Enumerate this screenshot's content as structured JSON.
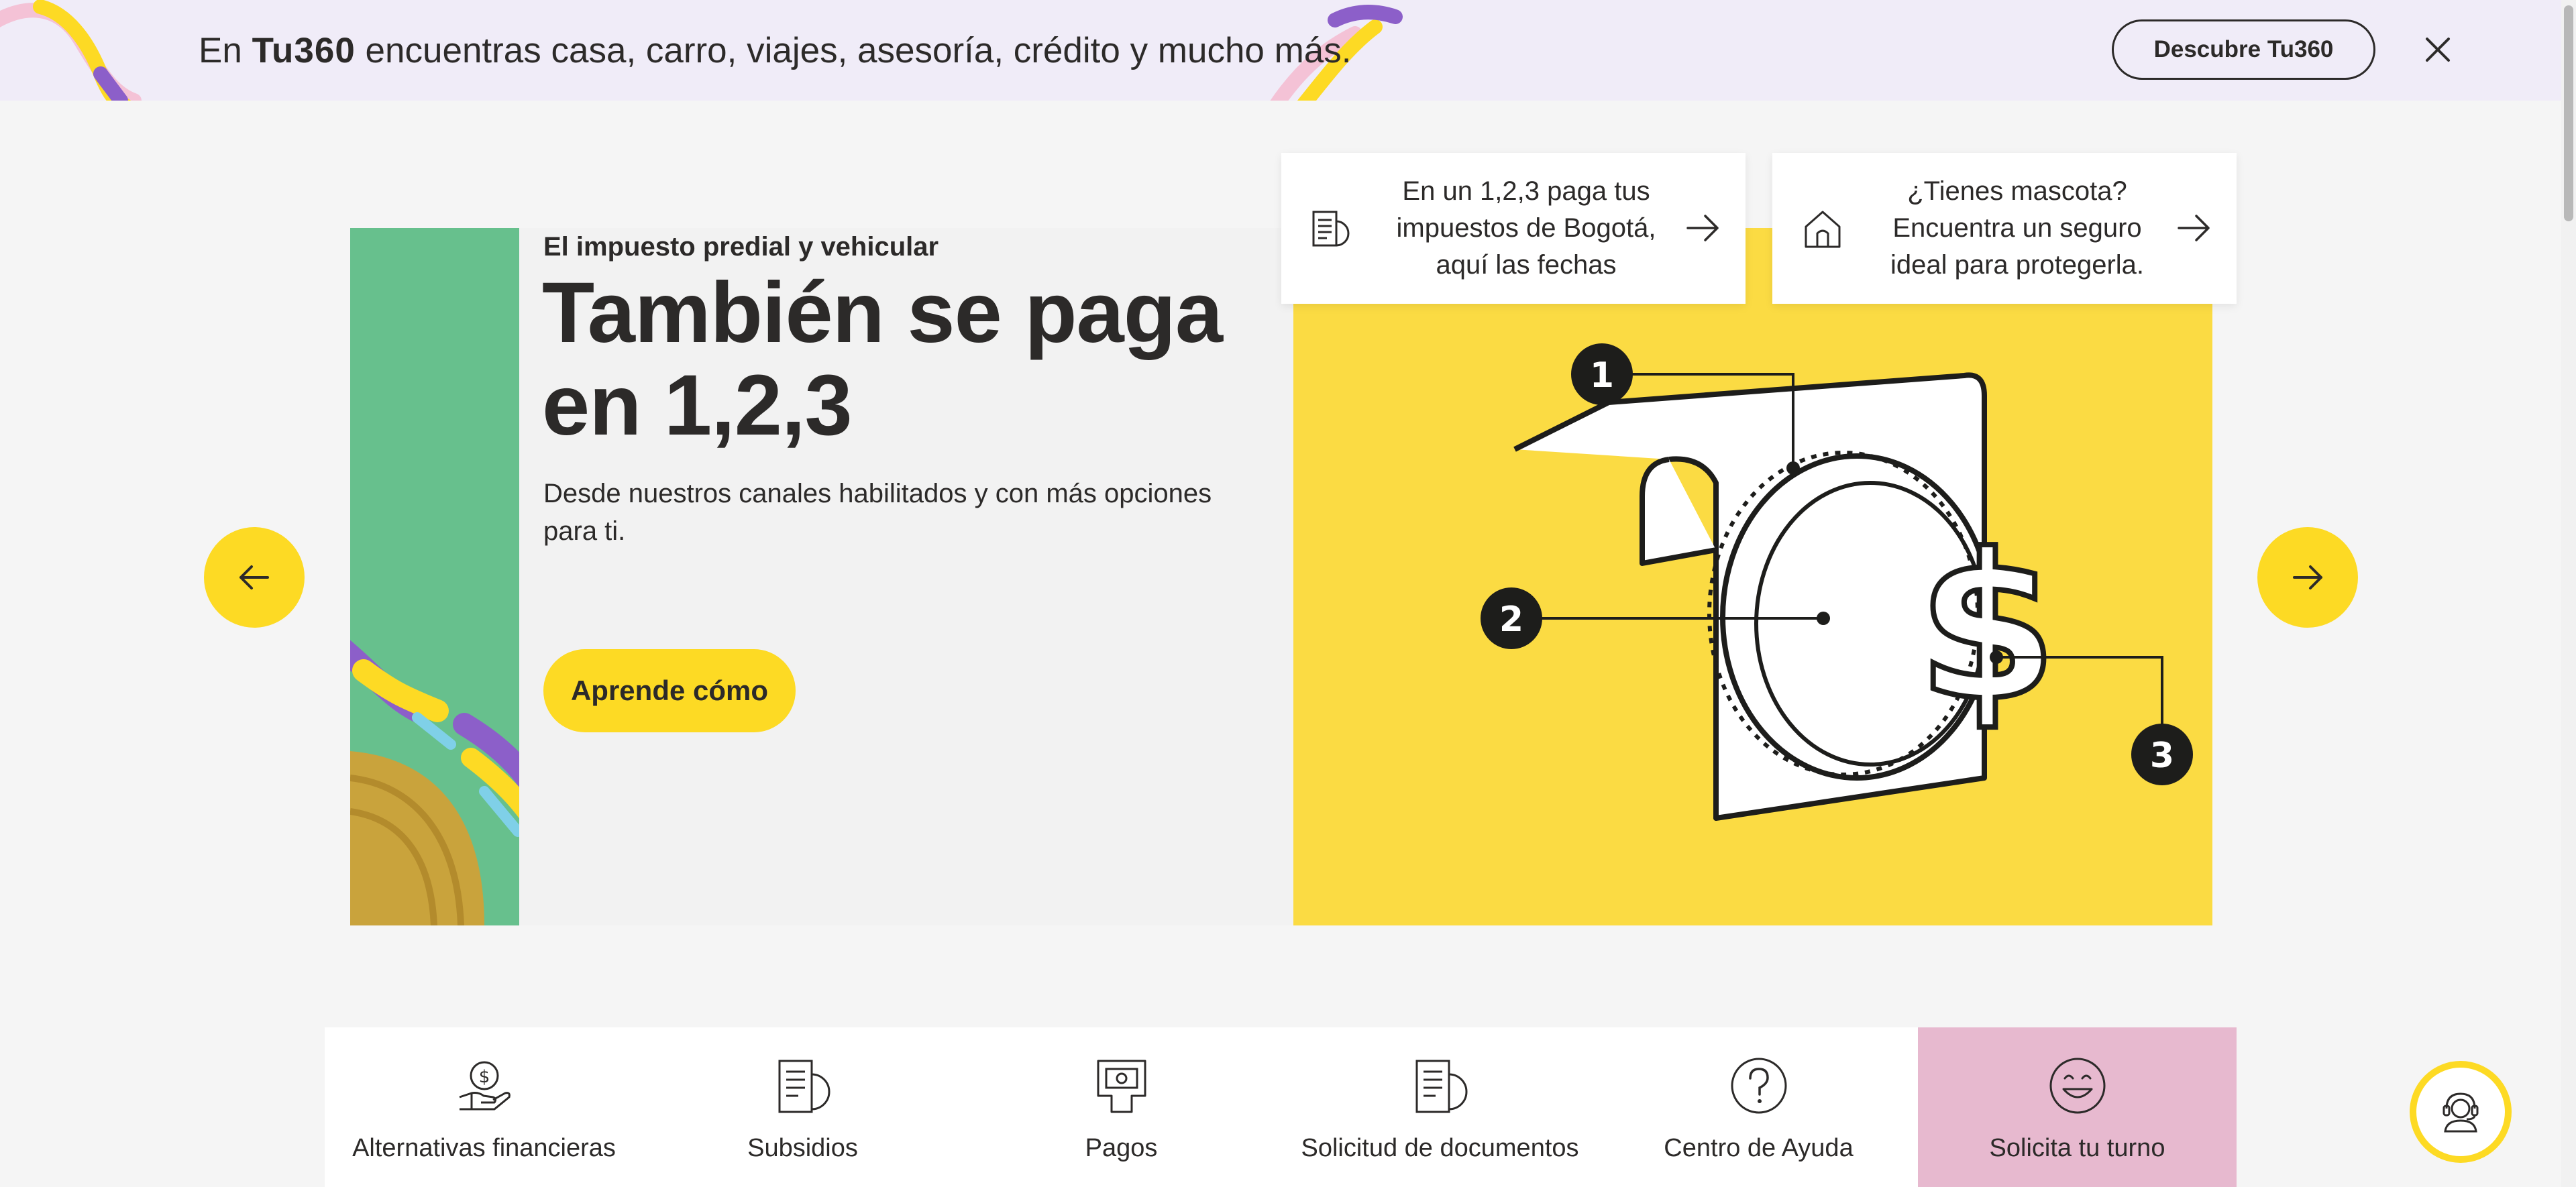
{
  "promo_banner": {
    "text_prefix": "En",
    "brand": "Tu360",
    "text_suffix": "encuentras casa, carro, viajes, asesoría, crédito y mucho más.",
    "cta_label": "Descubre Tu360",
    "close_icon": "close-icon"
  },
  "hero": {
    "eyebrow": "El impuesto predial y vehicular",
    "title": "También se paga en 1,2,3",
    "description": "Desde nuestros canales habilitados y con más opciones para ti.",
    "cta_label": "Aprende cómo",
    "prev_icon": "arrow-left-icon",
    "next_icon": "arrow-right-icon",
    "illustration_markers": [
      "1",
      "2",
      "3"
    ]
  },
  "info_cards": [
    {
      "icon": "document-icon",
      "text": "En un 1,2,3 paga tus impuestos de Bogotá, aquí las fechas",
      "arrow_icon": "arrow-right-icon"
    },
    {
      "icon": "house-icon",
      "text": "¿Tienes mascota? Encuentra un seguro ideal para protegerla.",
      "arrow_icon": "arrow-right-icon"
    }
  ],
  "quick_access": [
    {
      "label": "Alternativas financieras",
      "icon": "hand-money-icon"
    },
    {
      "label": "Subsidios",
      "icon": "document-icon"
    },
    {
      "label": "Pagos",
      "icon": "payment-icon"
    },
    {
      "label": "Solicitud de documentos",
      "icon": "document-icon"
    },
    {
      "label": "Centro de Ayuda",
      "icon": "question-icon"
    },
    {
      "label": "Solicita tu turno",
      "icon": "smile-icon"
    }
  ],
  "help_fab": {
    "icon": "support-agent-icon"
  },
  "colors": {
    "brand_yellow": "#fdda24",
    "hero_green": "#67c08d",
    "banner_bg": "#f0ecf8",
    "turno_pink": "#e7b9cf",
    "text_dark": "#2c2a29"
  }
}
